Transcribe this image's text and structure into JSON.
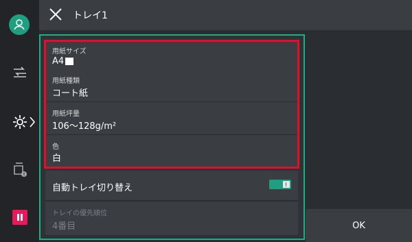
{
  "header": {
    "title": "トレイ1"
  },
  "panel": {
    "rows": [
      {
        "label": "用紙サイズ",
        "value": "A4"
      },
      {
        "label": "用紙種類",
        "value": "コート紙"
      },
      {
        "label": "用紙坪量",
        "value": "106〜128g/m²"
      },
      {
        "label": "色",
        "value": "白"
      }
    ],
    "auto_switch": {
      "label": "自動トレイ切り替え",
      "enabled": true
    },
    "priority": {
      "label": "トレイの優先順位",
      "value": "4番目"
    }
  },
  "footer": {
    "ok_label": "OK"
  },
  "colors": {
    "accent": "#1fae86",
    "highlight": "#e0102a",
    "pause": "#e8195a"
  }
}
